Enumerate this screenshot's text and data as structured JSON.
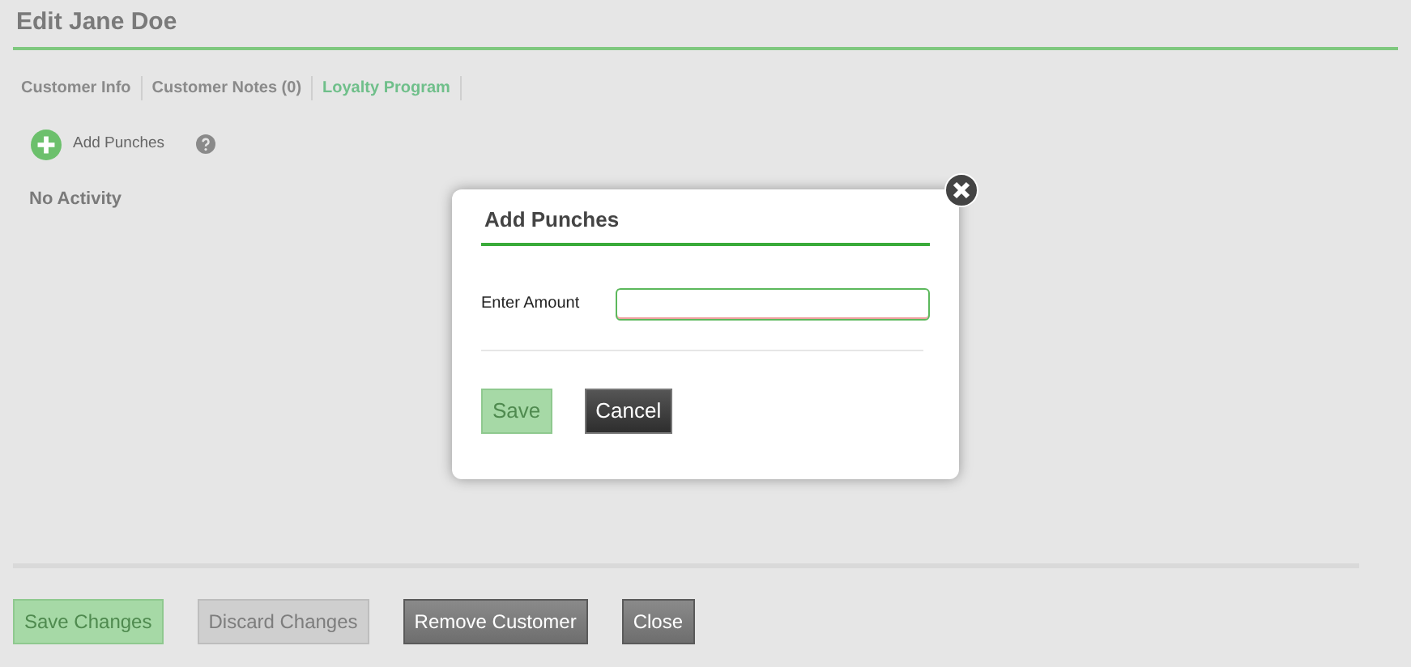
{
  "title": "Edit Jane Doe",
  "tabs": [
    {
      "label": "Customer Info",
      "selected": false
    },
    {
      "label": "Customer Notes (0)",
      "selected": false
    },
    {
      "label": "Loyalty Program",
      "selected": true
    }
  ],
  "add_action": {
    "label": "Add Punches"
  },
  "empty_message": "No Activity",
  "footer_buttons": [
    {
      "label": "Save Changes",
      "kind": "primary",
      "disabled": true
    },
    {
      "label": "Discard Changes",
      "kind": "secondary",
      "disabled": true
    },
    {
      "label": "Remove Customer",
      "kind": "dark",
      "disabled": false
    },
    {
      "label": "Close",
      "kind": "dark",
      "disabled": false
    }
  ],
  "dialog": {
    "title": "Add Punches",
    "field_label": "Enter Amount",
    "invalid": true,
    "buttons": [
      {
        "label": "Save",
        "kind": "primary",
        "disabled": true
      },
      {
        "label": "Cancel",
        "kind": "black",
        "disabled": false
      }
    ]
  }
}
